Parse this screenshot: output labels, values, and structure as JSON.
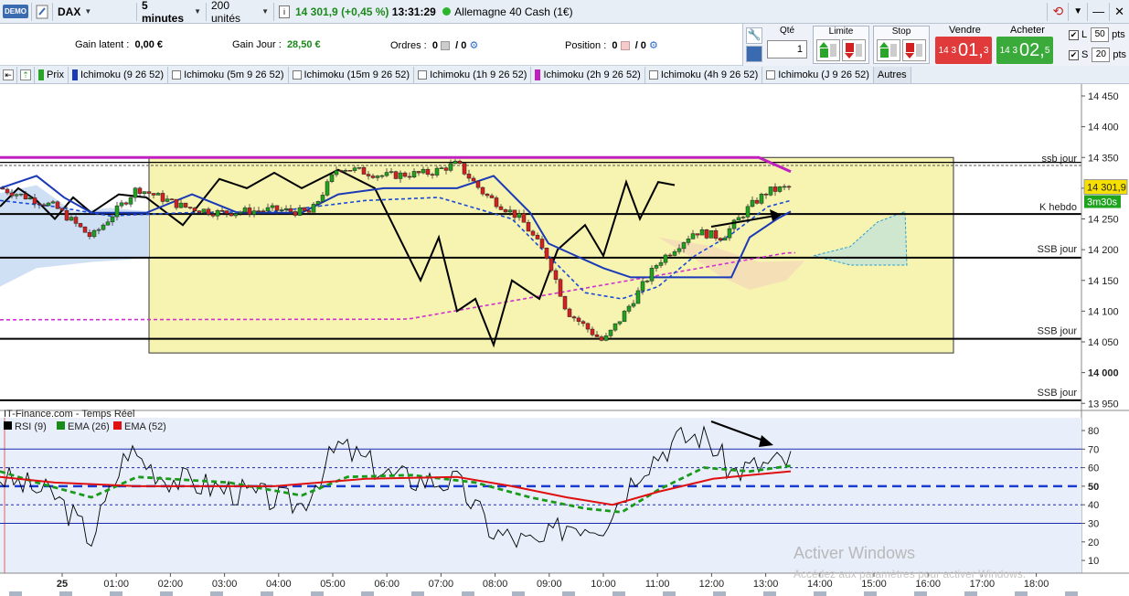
{
  "toolbar": {
    "logo": "DEMO",
    "instrument": "DAX",
    "timeframe": "5 minutes",
    "units": "200 unités",
    "price": "14 301,9",
    "change": "(+0,45 %)",
    "time": "13:31:29",
    "market": "Allemagne 40 Cash (1€)"
  },
  "info": {
    "gain_latent_label": "Gain latent :",
    "gain_latent_value": "0,00 €",
    "gain_jour_label": "Gain Jour :",
    "gain_jour_value": "28,50 €",
    "ordres_label": "Ordres :",
    "ordres_value": "0",
    "ordres_sep": "/ 0",
    "position_label": "Position :",
    "position_value": "0",
    "position_sep": "/ 0"
  },
  "order_panel": {
    "qte_label": "Qté",
    "qte_value": "1",
    "limite_label": "Limite",
    "stop_label": "Stop",
    "vendre_label": "Vendre",
    "vendre_small": "14 3",
    "vendre_big": "01,",
    "vendre_sup": "3",
    "acheter_label": "Acheter",
    "acheter_small": "14 3",
    "acheter_big": "02,",
    "acheter_sup": "5",
    "l_label": "L",
    "l_value": "50",
    "s_label": "S",
    "s_value": "20",
    "pts": "pts"
  },
  "tabs": [
    {
      "label": "Prix",
      "color": "#2aa52a"
    },
    {
      "label": "Ichimoku (9 26 52)",
      "color": "#1a3ab8"
    },
    {
      "label": "Ichimoku (5m 9 26 52)",
      "color": ""
    },
    {
      "label": "Ichimoku (15m 9 26 52)",
      "color": ""
    },
    {
      "label": "Ichimoku (1h 9 26 52)",
      "color": ""
    },
    {
      "label": "Ichimoku (2h 9 26 52)",
      "color": "#c020c0"
    },
    {
      "label": "Ichimoku (4h 9 26 52)",
      "color": ""
    },
    {
      "label": "Ichimoku (J 9 26 52)",
      "color": ""
    }
  ],
  "tabs_more": "Autres",
  "price_axis": [
    "14 450",
    "14 400",
    "14 350",
    "14 300",
    "14 250",
    "14 200",
    "14 150",
    "14 100",
    "14 050",
    "14 000",
    "13 950"
  ],
  "price_levels": {
    "ssb_jour_top": "ssb jour",
    "k_hebdo": "K hebdo",
    "ssb_jour_1": "SSB jour",
    "ssb_jour_2": "SSB jour",
    "ssb_jour_3": "SSB jour",
    "current": "14 301,9",
    "countdown": "3m30s"
  },
  "rsi_panel": {
    "title": "IT-Finance.com - Temps Réel",
    "legend": [
      {
        "label": "RSI (9)",
        "color": "#000000"
      },
      {
        "label": "EMA (26)",
        "color": "#1a8a1a"
      },
      {
        "label": "EMA (52)",
        "color": "#e01010"
      }
    ],
    "axis": [
      "80",
      "70",
      "60",
      "50",
      "40",
      "30",
      "20",
      "10"
    ]
  },
  "time_axis": [
    "25",
    "01:00",
    "02:00",
    "03:00",
    "04:00",
    "05:00",
    "06:00",
    "07:00",
    "08:00",
    "09:00",
    "10:00",
    "11:00",
    "12:00",
    "13:00",
    "14:00",
    "15:00",
    "16:00",
    "17:00",
    "18:00"
  ],
  "watermark": {
    "title": "Activer Windows",
    "subtitle": "Accédez aux paramètres pour activer Windows."
  },
  "colors": {
    "up": "#1fa31f",
    "down": "#d42020",
    "tenkan": "#1a3ab8",
    "kijun": "#c020c0",
    "zone": "#f7f3b0"
  }
}
